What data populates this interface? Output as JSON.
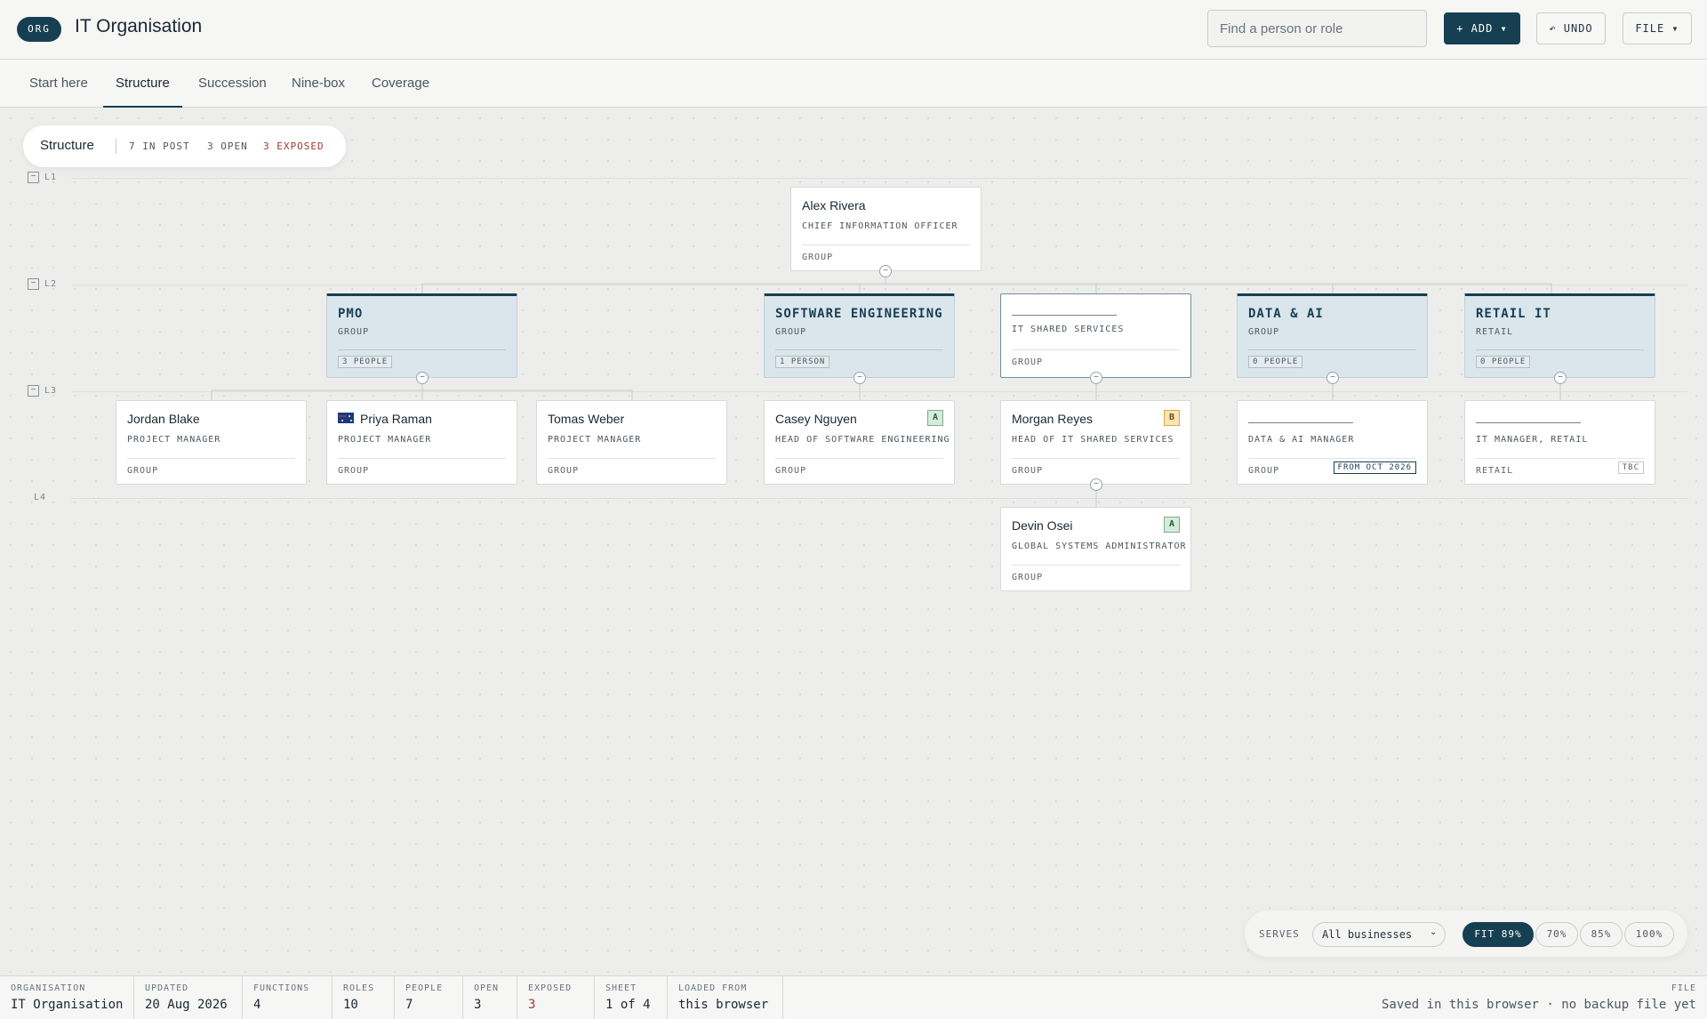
{
  "header": {
    "logo": "ORG",
    "title": "IT Organisation",
    "search_placeholder": "Find a person or role",
    "add_label": "+ ADD ▾",
    "undo_label": "↶ UNDO",
    "file_label": "FILE ▾"
  },
  "tabs": [
    {
      "label": "Start here"
    },
    {
      "label": "Structure",
      "active": true
    },
    {
      "label": "Succession"
    },
    {
      "label": "Nine-box"
    },
    {
      "label": "Coverage"
    }
  ],
  "summary": {
    "title": "Structure",
    "in_post": "7 IN POST",
    "open": "3 OPEN",
    "exposed": "3 EXPOSED"
  },
  "levels": [
    "L1",
    "L2",
    "L3",
    "L4"
  ],
  "root": {
    "name": "Alex Rivera",
    "role": "CHIEF INFORMATION OFFICER",
    "scope": "GROUP"
  },
  "functions": [
    {
      "name": "PMO",
      "scope": "GROUP",
      "count": "3 PEOPLE"
    },
    {
      "name": "SOFTWARE ENGINEERING",
      "scope": "GROUP",
      "count": "1 PERSON"
    },
    {
      "role": "IT SHARED SERVICES",
      "scope": "GROUP"
    },
    {
      "name": "DATA & AI",
      "scope": "GROUP",
      "count": "0 PEOPLE"
    },
    {
      "name": "RETAIL IT",
      "scope": "RETAIL",
      "count": "0 PEOPLE"
    }
  ],
  "people": [
    {
      "name": "Jordan Blake",
      "role": "PROJECT MANAGER",
      "scope": "GROUP"
    },
    {
      "name": "Priya Raman",
      "role": "PROJECT MANAGER",
      "scope": "GROUP",
      "flag": "australia-flag-icon"
    },
    {
      "name": "Tomas Weber",
      "role": "PROJECT MANAGER",
      "scope": "GROUP"
    },
    {
      "name": "Casey Nguyen",
      "role": "HEAD OF SOFTWARE ENGINEERING",
      "scope": "GROUP",
      "badge": "A"
    },
    {
      "name": "Morgan Reyes",
      "role": "HEAD OF IT SHARED SERVICES",
      "scope": "GROUP",
      "badge": "B"
    },
    {
      "role": "DATA & AI MANAGER",
      "scope": "GROUP",
      "tag": "FROM OCT 2026"
    },
    {
      "role": "IT MANAGER, RETAIL",
      "scope": "RETAIL",
      "tag": "TBC"
    },
    {
      "name": "Devin Osei",
      "role": "GLOBAL SYSTEMS ADMINISTRATOR",
      "scope": "GROUP",
      "badge": "A"
    }
  ],
  "zoom": {
    "serves_label": "SERVES",
    "serves_value": "All businesses",
    "options": [
      "FIT 89%",
      "70%",
      "85%",
      "100%"
    ],
    "active": "FIT 89%"
  },
  "status": {
    "organisation": {
      "label": "ORGANISATION",
      "value": "IT Organisation"
    },
    "updated": {
      "label": "UPDATED",
      "value": "20 Aug 2026"
    },
    "functions": {
      "label": "FUNCTIONS",
      "value": "4"
    },
    "roles": {
      "label": "ROLES",
      "value": "10"
    },
    "people": {
      "label": "PEOPLE",
      "value": "7"
    },
    "open": {
      "label": "OPEN",
      "value": "3"
    },
    "exposed": {
      "label": "EXPOSED",
      "value": "3"
    },
    "sheet": {
      "label": "SHEET",
      "value": "1 of 4"
    },
    "loaded": {
      "label": "LOADED FROM",
      "value": "this browser"
    },
    "file": {
      "label": "FILE",
      "value": "Saved in this browser · no backup file yet"
    }
  },
  "colors": {
    "accent": "#173f52",
    "exposed": "#a3392a",
    "badge_a": "#d7eadb",
    "badge_b": "#fbe4b8"
  }
}
